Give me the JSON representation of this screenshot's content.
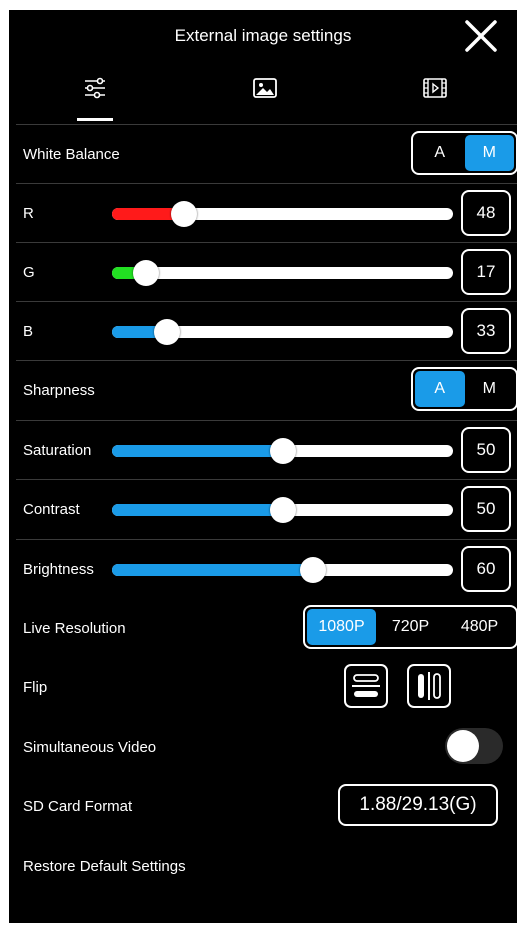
{
  "header": {
    "title": "External image settings"
  },
  "tabs": [
    {
      "icon": "sliders-icon",
      "active": true
    },
    {
      "icon": "image-icon",
      "active": false
    },
    {
      "icon": "film-icon",
      "active": false
    }
  ],
  "white_balance": {
    "label": "White Balance",
    "options": [
      "A",
      "M"
    ],
    "selected": "M"
  },
  "r": {
    "label": "R",
    "value": "48",
    "level": 0.21,
    "color": "#ff1a1a"
  },
  "g": {
    "label": "G",
    "value": "17",
    "level": 0.1,
    "color": "#22e022"
  },
  "b": {
    "label": "B",
    "value": "33",
    "level": 0.16,
    "color": "#1a9be8"
  },
  "sharpness": {
    "label": "Sharpness",
    "options": [
      "A",
      "M"
    ],
    "selected": "A"
  },
  "saturation": {
    "label": "Saturation",
    "value": "50",
    "level": 0.5,
    "color": "#1a9be8"
  },
  "contrast": {
    "label": "Contrast",
    "value": "50",
    "level": 0.5,
    "color": "#1a9be8"
  },
  "brightness": {
    "label": "Brightness",
    "value": "60",
    "level": 0.59,
    "color": "#1a9be8"
  },
  "live_resolution": {
    "label": "Live Resolution",
    "options": [
      "1080P",
      "720P",
      "480P"
    ],
    "selected": "1080P"
  },
  "flip": {
    "label": "Flip"
  },
  "simultaneous_video": {
    "label": "Simultaneous Video",
    "on": false
  },
  "sd_card": {
    "label": "SD Card Format",
    "value": "1.88/29.13(G)"
  },
  "restore": {
    "label": "Restore Default Settings"
  },
  "accent_color": "#1a9be8"
}
